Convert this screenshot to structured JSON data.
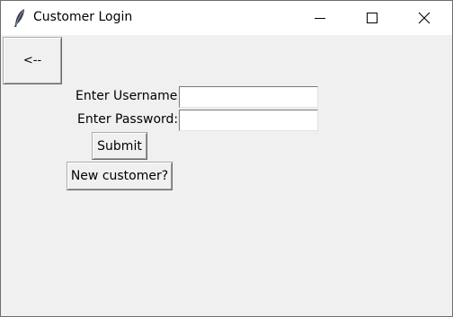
{
  "window": {
    "title": "Customer Login",
    "icon": "feather-icon",
    "controls": [
      "minimize-icon",
      "maximize-icon",
      "close-icon"
    ]
  },
  "nav": {
    "back_label": "<--"
  },
  "form": {
    "username_label": "Enter Username:",
    "username_value": "",
    "password_label": "Enter Password:",
    "password_value": "",
    "submit_label": "Submit",
    "new_customer_label": "New customer?"
  }
}
